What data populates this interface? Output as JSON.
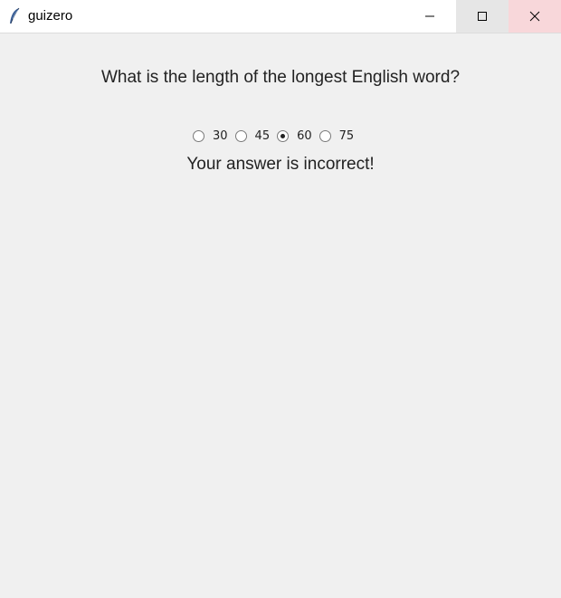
{
  "window": {
    "title": "guizero",
    "icon": "feather-icon",
    "controls": [
      "minimize-icon",
      "maximize-icon",
      "close-icon"
    ]
  },
  "question": "What is the length of the longest English word?",
  "options": [
    {
      "label": "30",
      "selected": false
    },
    {
      "label": "45",
      "selected": false
    },
    {
      "label": "60",
      "selected": true
    },
    {
      "label": "75",
      "selected": false
    }
  ],
  "result": "Your answer is incorrect!"
}
